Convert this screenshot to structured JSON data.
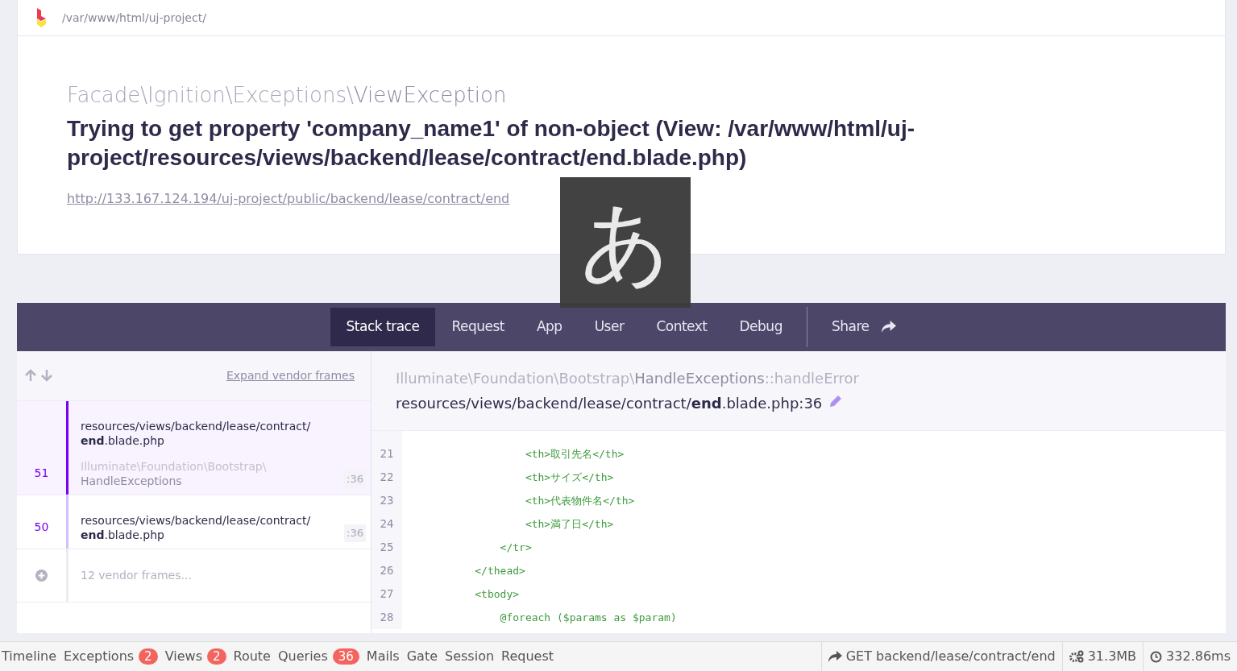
{
  "header": {
    "path": "/var/www/html/uj-project/"
  },
  "exception": {
    "namespace": "Facade\\Ignition\\Exceptions\\",
    "class": "ViewException",
    "message": "Trying to get property 'company_name1' of non-object (View: /var/www/html/uj-project/resources/views/backend/lease/contract/end.blade.php)",
    "url": "http://133.167.124.194/uj-project/public/backend/lease/contract/end"
  },
  "ime_indicator": {
    "glyph": "あ"
  },
  "tabs": [
    {
      "label": "Stack trace",
      "selected": true
    },
    {
      "label": "Request",
      "selected": false
    },
    {
      "label": "App",
      "selected": false
    },
    {
      "label": "User",
      "selected": false
    },
    {
      "label": "Context",
      "selected": false
    },
    {
      "label": "Debug",
      "selected": false
    }
  ],
  "share": {
    "label": "Share"
  },
  "frames_toolbar": {
    "expand_link": "Expand vendor frames"
  },
  "frames": [
    {
      "kind": "frame",
      "number": "51",
      "path": "resources/views/backend/lease/contract/",
      "file": "**end**.blade.php",
      "class_namespace": "Illuminate\\Foundation\\Bootstrap\\",
      "class_name": "HandleExceptions",
      "line": ":36",
      "selected": true
    },
    {
      "kind": "frame",
      "number": "50",
      "path": "resources/views/backend/lease/contract/",
      "file": "**end**.blade.php",
      "line": ":36",
      "selected": false
    },
    {
      "kind": "vendor",
      "label": "12 vendor frames..."
    }
  ],
  "code_header": {
    "namespace": "Illuminate\\Foundation\\Bootstrap\\",
    "class": "HandleExceptions",
    "method": "::handleError",
    "file": "resources/views/backend/lease/contract/**end**.blade.php:36"
  },
  "code_lines": [
    {
      "number": "21",
      "code": "                  <th>取引先名</th>"
    },
    {
      "number": "22",
      "code": "                  <th>サイズ</th>"
    },
    {
      "number": "23",
      "code": "                  <th>代表物件名</th>"
    },
    {
      "number": "24",
      "code": "                  <th>満了日</th>"
    },
    {
      "number": "25",
      "code": "              </tr>"
    },
    {
      "number": "26",
      "code": "          </thead>"
    },
    {
      "number": "27",
      "code": "          <tbody>"
    },
    {
      "number": "28",
      "code": "              @foreach ($params as $param)"
    }
  ],
  "debugbar": {
    "tabs": [
      {
        "label": "Timeline"
      },
      {
        "label": "Exceptions",
        "badge": "2"
      },
      {
        "label": "Views",
        "badge": "2"
      },
      {
        "label": "Route"
      },
      {
        "label": "Queries",
        "badge": "36"
      },
      {
        "label": "Mails"
      },
      {
        "label": "Gate"
      },
      {
        "label": "Session"
      },
      {
        "label": "Request"
      }
    ],
    "route": "GET backend/lease/contract/end",
    "memory": "31.3MB",
    "time": "332.86ms"
  }
}
